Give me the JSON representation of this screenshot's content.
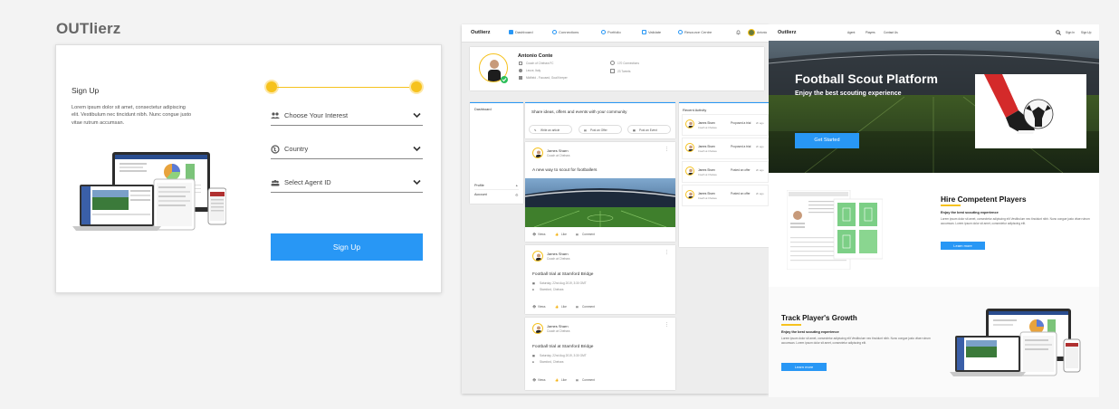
{
  "brand": "OUTlierz",
  "signup": {
    "title": "Sign Up",
    "description": "Lorem ipsum dolor sit amet, consectetur adipiscing elit. Vestibulum nec tincidunt nibh. Nunc congue justo vitae rutrum accumsan.",
    "fields": [
      {
        "label": "Choose Your Interest",
        "icon": "interest-icon"
      },
      {
        "label": "Country",
        "icon": "globe-icon"
      },
      {
        "label": "Select Agent ID",
        "icon": "agent-icon"
      }
    ],
    "button": "Sign Up",
    "accent": "#f6c21e",
    "button_color": "#2897f5"
  },
  "dashboard": {
    "logo": "Outlierz",
    "nav": [
      "Dashboard",
      "Connections",
      "Portfolio",
      "Validate",
      "Resource Centre"
    ],
    "user_short": "Antonio",
    "profile": {
      "name": "Antonio Conte",
      "club": "Coach of Chelsea FC",
      "location": "Lecce, Italy",
      "role": "Midfield - Focused, Goal Keeper",
      "connections": "170 Connections",
      "tweets": "23 Tweets"
    },
    "sidebar": {
      "dashboard": "Dashboard",
      "profile": "Profile",
      "account": "Account"
    },
    "share": {
      "prompt": "Share ideas, offers and events with your community",
      "actions": [
        "Write an article",
        "Post an Offer",
        "Post an Event"
      ]
    },
    "posts": [
      {
        "author": "James Sharn",
        "sub": "Coach at Chelsea",
        "title": "A new way to scout for footballers",
        "type": "image"
      },
      {
        "author": "James Sharn",
        "sub": "Coach at Chelsea",
        "title": "Football trial at Stamford Bridge",
        "date": "Saturday, 22nd Aug 2019, 3:30 GMT",
        "place": "Stamford, Chelsea"
      },
      {
        "author": "James Sharn",
        "sub": "Coach at Chelsea",
        "title": "Football trial at Stamford Bridge",
        "date": "Saturday, 22nd Aug 2019, 3:30 GMT",
        "place": "Stamford, Chelsea"
      }
    ],
    "post_actions": [
      "Views",
      "Like",
      "Comment"
    ],
    "activity": {
      "title": "Recent Activity",
      "items": [
        {
          "name": "James Sharn",
          "sub": "Coach at Chelsea",
          "action": "Proposed a trial",
          "time": "2h ago"
        },
        {
          "name": "James Sharn",
          "sub": "Coach at Chelsea",
          "action": "Proposed a trial",
          "time": "2h ago"
        },
        {
          "name": "James Sharn",
          "sub": "Coach at Chelsea",
          "action": "Posted an offer",
          "time": "2h ago"
        },
        {
          "name": "James Sharn",
          "sub": "Coach at Chelsea",
          "action": "Posted an offer",
          "time": "2h ago"
        }
      ]
    }
  },
  "landing": {
    "logo": "Outlierz",
    "nav": [
      "Agent",
      "Players",
      "Contact Us"
    ],
    "right_nav": [
      "Sign In",
      "Sign Up"
    ],
    "hero": {
      "title": "Football Scout Platform",
      "subtitle": "Enjoy the best scouting experience",
      "button": "Get Started"
    },
    "hire": {
      "title": "Hire Competent Players",
      "subtitle": "Enjoy the best scouting experience",
      "body": "Lorem ipsum dolor sit amet, consectetur adipiscing elit Vestibulum nec tincidunt nibh. Nunc congue justo vitae rutrum accumsan. Lorem ipsum dolor sit amet, consectetur adipiscing elit.",
      "button": "Learn more"
    },
    "track": {
      "title": "Track Player's Growth",
      "subtitle": "Enjoy the best scouting experience",
      "body": "Lorem ipsum dolor sit amet, consectetur adipiscing elit Vestibulum nec tincidunt nibh. Nunc congue justo vitae rutrum accumsan. Lorem ipsum dolor sit amet, consectetur adipiscing elit.",
      "button": "Learn more"
    }
  }
}
